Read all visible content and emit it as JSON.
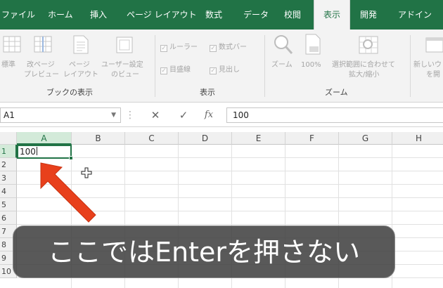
{
  "ribbon_tabs": {
    "file": "ファイル",
    "home": "ホーム",
    "insert": "挿入",
    "page_layout": "ページ レイアウト",
    "formulas": "数式",
    "data": "データ",
    "review": "校閲",
    "view": "表示",
    "developer": "開発",
    "addins": "アドイン",
    "active": "表示"
  },
  "ribbon": {
    "workbook_views": {
      "normal": "標準",
      "page_break_1": "改ページ",
      "page_break_2": "プレビュー",
      "page_layout_1": "ページ",
      "page_layout_2": "レイアウト",
      "custom_1": "ユーザー設定",
      "custom_2": "のビュー",
      "group": "ブックの表示"
    },
    "show": {
      "ruler": "ルーラー",
      "formula_bar": "数式バー",
      "gridlines": "目盛線",
      "headings": "見出し",
      "group": "表示"
    },
    "zoom": {
      "zoom": "ズーム",
      "zoom_100": "100%",
      "zoom_sel_1": "選択範囲に合わせて",
      "zoom_sel_2": "拡大/縮小",
      "group": "ズーム"
    },
    "window": {
      "new_window_1": "新しいウ",
      "new_window_2": "を開"
    }
  },
  "formula_bar": {
    "name_box": "A1",
    "fx": "fx",
    "content": "100"
  },
  "sheet": {
    "columns": [
      "A",
      "B",
      "C",
      "D",
      "E",
      "F",
      "G",
      "H"
    ],
    "rows": [
      "1",
      "2",
      "3",
      "4",
      "5",
      "6",
      "7",
      "8",
      "9",
      "10"
    ],
    "active_cell_value": "100"
  },
  "caption": "ここではEnterを押さない",
  "colors": {
    "accent": "#217346",
    "arrow": "#e8401c"
  }
}
